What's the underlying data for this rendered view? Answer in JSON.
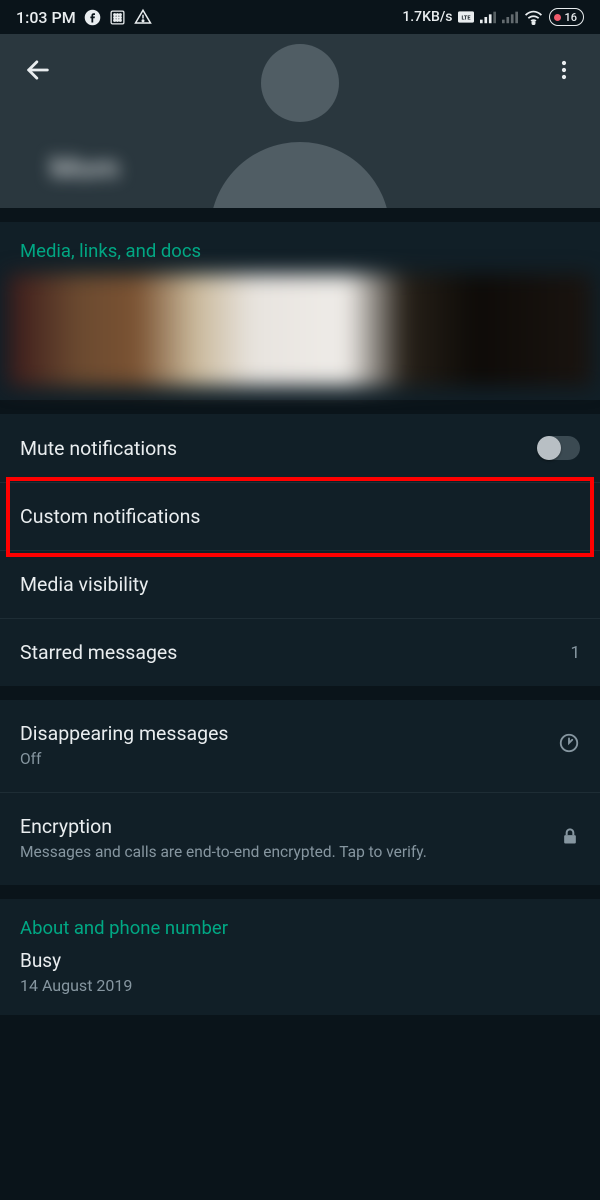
{
  "statusbar": {
    "time": "1:03 PM",
    "network_speed": "1.7KB/s",
    "battery_percent": "16"
  },
  "header": {
    "contact_name": "Mom"
  },
  "media_section": {
    "title": "Media, links, and docs"
  },
  "settings": {
    "mute": {
      "label": "Mute notifications",
      "enabled": false
    },
    "custom": {
      "label": "Custom notifications"
    },
    "media_vis": {
      "label": "Media visibility"
    },
    "starred": {
      "label": "Starred messages",
      "count": "1"
    },
    "disappearing": {
      "label": "Disappearing messages",
      "value": "Off"
    },
    "encryption": {
      "label": "Encryption",
      "desc": "Messages and calls are end-to-end encrypted. Tap to verify."
    }
  },
  "about": {
    "header": "About and phone number",
    "status": "Busy",
    "date": "14 August 2019"
  }
}
